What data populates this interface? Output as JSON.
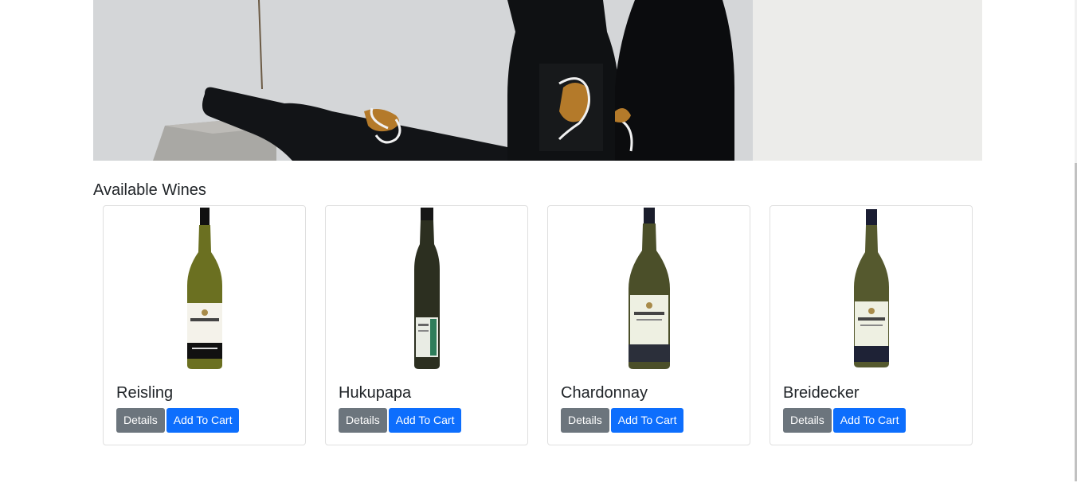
{
  "section_title": "Available Wines",
  "hero": {
    "image_name": "wine-bottles-hero-image"
  },
  "wines": [
    {
      "name": "Reisling",
      "details_label": "Details",
      "cart_label": "Add To Cart",
      "bottle_color": "#6b7021",
      "label_band": "#111111"
    },
    {
      "name": "Hukupapa",
      "details_label": "Details",
      "cart_label": "Add To Cart",
      "bottle_color": "#2c2f20",
      "label_band": "#2f2f2f"
    },
    {
      "name": "Chardonnay",
      "details_label": "Details",
      "cart_label": "Add To Cart",
      "bottle_color": "#4b4f29",
      "label_band": "#2b2f3a"
    },
    {
      "name": "Breidecker",
      "details_label": "Details",
      "cart_label": "Add To Cart",
      "bottle_color": "#55592e",
      "label_band": "#1e2236"
    }
  ],
  "colors": {
    "details_button": "#6c757d",
    "cart_button": "#0d6efd"
  }
}
